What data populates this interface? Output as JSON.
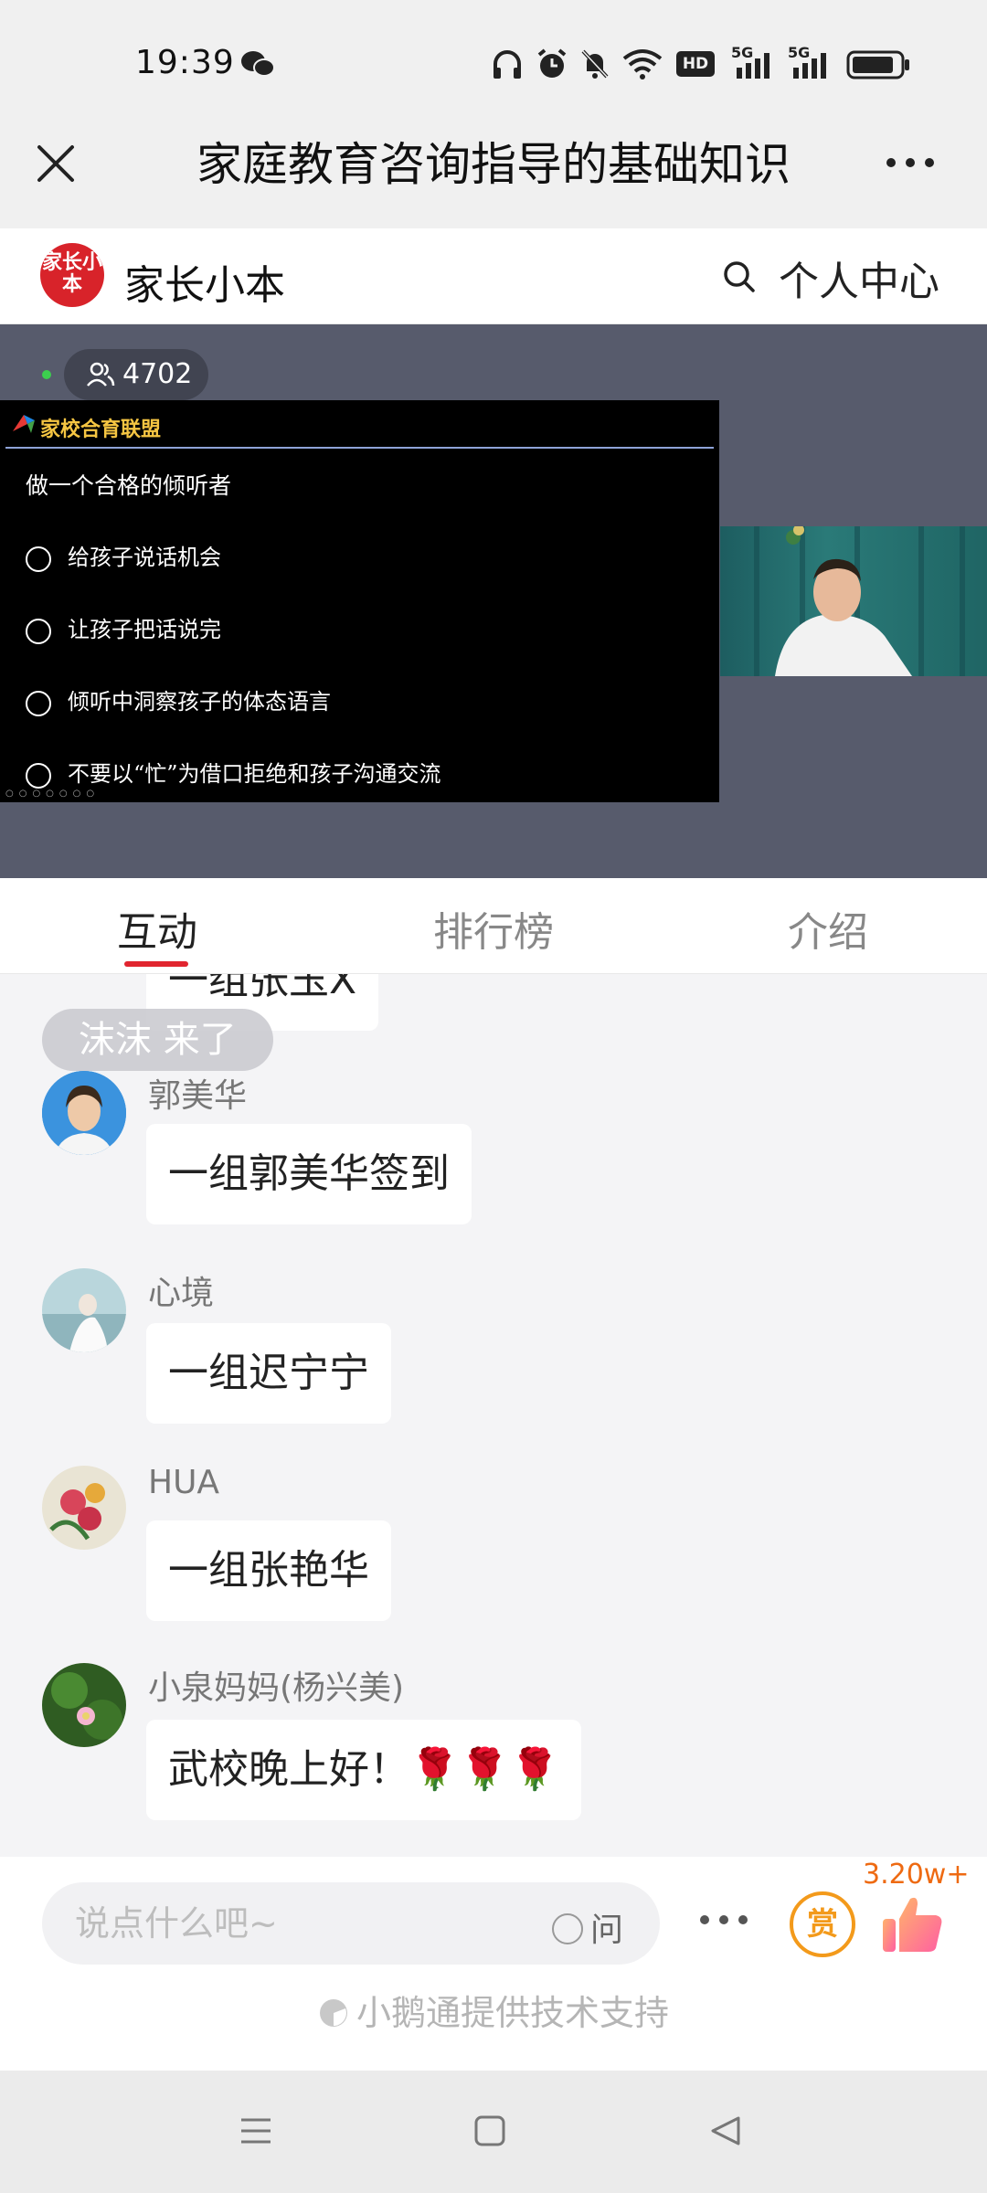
{
  "status_bar": {
    "time": "19:39",
    "network_badge": "HD",
    "signal_1": "5G",
    "signal_2": "5G"
  },
  "title_bar": {
    "title": "家庭教育咨询指导的基础知识"
  },
  "app_header": {
    "logo_text": "家长小本",
    "brand": "家长小本",
    "personal_center": "个人中心"
  },
  "live": {
    "viewer_count": "4702",
    "slide": {
      "banner": "家校合育联盟",
      "heading": "做一个合格的倾听者",
      "items": [
        "给孩子说话机会",
        "让孩子把话说完",
        "倾听中洞察孩子的体态语言",
        "不要以“忙”为借口拒绝和孩子沟通交流"
      ]
    }
  },
  "tabs": [
    {
      "label": "互动",
      "active": true
    },
    {
      "label": "排行榜",
      "active": false
    },
    {
      "label": "介绍",
      "active": false
    }
  ],
  "chat": {
    "partial_message": "一组张玉Ⅹ",
    "join_notice": "沫沫 来了",
    "messages": [
      {
        "user": "郭美华",
        "text": "一组郭美华签到"
      },
      {
        "user": "心境",
        "text": "一组迟宁宁"
      },
      {
        "user": "HUA",
        "text": "一组张艳华"
      },
      {
        "user": "小泉妈妈(杨兴美)",
        "text": "武校晚上好！🌹🌹🌹"
      }
    ]
  },
  "input_bar": {
    "placeholder": "说点什么吧~",
    "ask_label": "问",
    "reward_label": "赏",
    "like_count": "3.20w+",
    "powered_by": "小鹅通提供技术支持"
  },
  "colors": {
    "accent": "#e1252f",
    "reward": "#f39a1b",
    "like": "#ee6a12",
    "video_bg": "#575b6c"
  }
}
